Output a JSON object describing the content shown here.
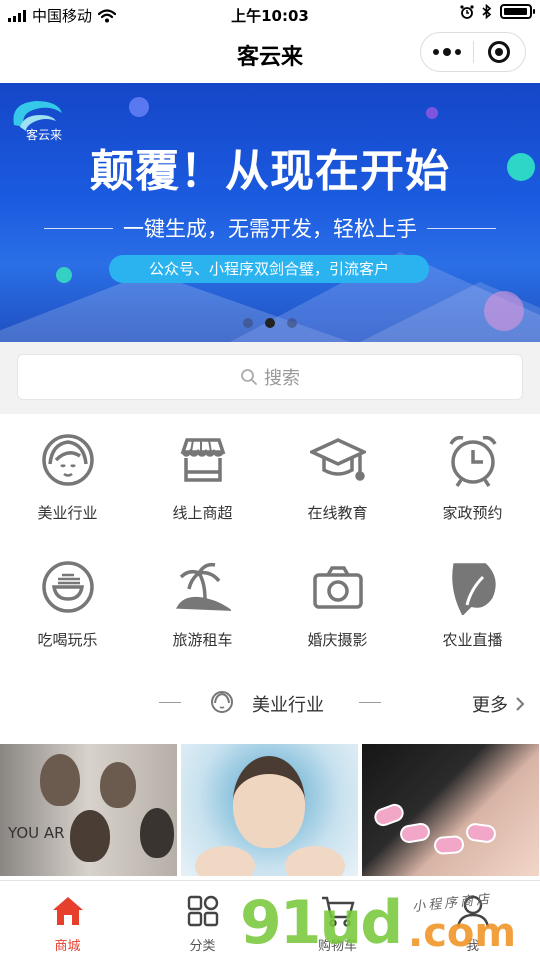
{
  "status_bar": {
    "carrier": "中国移动",
    "time": "上午10:03"
  },
  "nav": {
    "title": "客云来"
  },
  "banner": {
    "logo_text": "客云来",
    "headline": "颠覆！从现在开始",
    "subline": "一键生成，无需开发，轻松上手",
    "pill_text": "公众号、小程序双剑合璧，引流客户",
    "slide_count": 3,
    "active_slide": 2
  },
  "search": {
    "placeholder": "搜索"
  },
  "categories": [
    {
      "label": "美业行业",
      "icon": "woman-face-icon"
    },
    {
      "label": "线上商超",
      "icon": "storefront-icon"
    },
    {
      "label": "在线教育",
      "icon": "graduation-cap-icon"
    },
    {
      "label": "家政预约",
      "icon": "alarm-clock-icon"
    },
    {
      "label": "吃喝玩乐",
      "icon": "noodle-bowl-icon"
    },
    {
      "label": "旅游租车",
      "icon": "palm-island-icon"
    },
    {
      "label": "婚庆摄影",
      "icon": "camera-icon"
    },
    {
      "label": "农业直播",
      "icon": "leaf-icon"
    }
  ],
  "section": {
    "title": "美业行业",
    "more_label": "更多"
  },
  "products": [
    {
      "name": "hair-salon-poster",
      "text": "YOU AR"
    },
    {
      "name": "skincare-model"
    },
    {
      "name": "nail-art"
    }
  ],
  "tabbar": {
    "tabs": [
      {
        "label": "商城",
        "icon": "home-icon",
        "active": true
      },
      {
        "label": "分类",
        "icon": "category-grid-icon",
        "active": false
      },
      {
        "label": "购物车",
        "icon": "shopping-cart-icon",
        "active": false
      },
      {
        "label": "我",
        "icon": "user-icon",
        "active": false
      }
    ]
  },
  "watermark": {
    "main": "91ud",
    "domain": ".com",
    "small": "小程序商店"
  },
  "colors": {
    "accent": "#e6402d",
    "banner_blue": "#1b5be0",
    "pill_blue": "#2bb3f0",
    "icon_gray": "#777777"
  }
}
